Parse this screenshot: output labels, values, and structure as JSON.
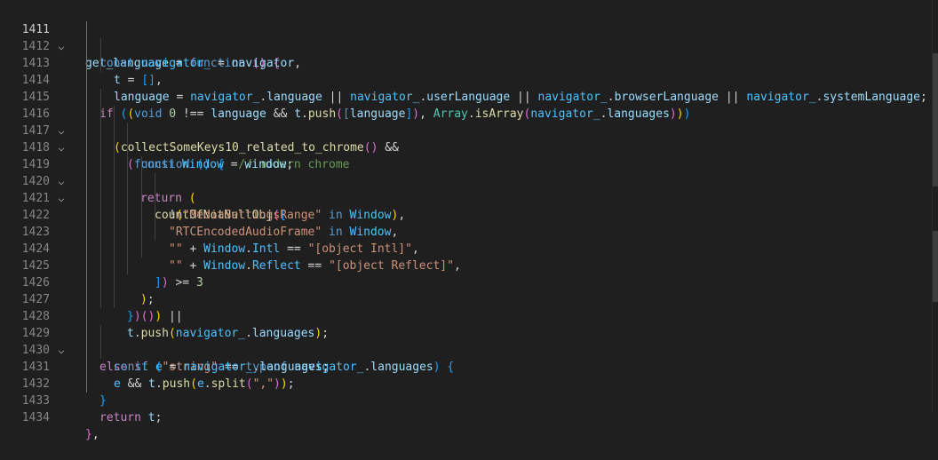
{
  "editor": {
    "line_numbers": [
      "1411",
      "1412",
      "1413",
      "1414",
      "1415",
      "1416",
      "1417",
      "1418",
      "1419",
      "1420",
      "1421",
      "1422",
      "1423",
      "1424",
      "1425",
      "1426",
      "1427",
      "1428",
      "1429",
      "1430",
      "1431",
      "1432",
      "1433",
      "1434"
    ],
    "code": {
      "l1411": [
        "get_language",
        " = ",
        "function",
        " ",
        "(",
        ")",
        " ",
        "{"
      ],
      "l1412": [
        "const",
        " ",
        "navigator_",
        " = ",
        "navigator",
        ","
      ],
      "l1413": [
        "t",
        " = ",
        "[",
        "]",
        ","
      ],
      "l1414": [
        "language",
        " = ",
        "navigator_",
        ".",
        "language",
        " || ",
        "navigator_",
        ".",
        "userLanguage",
        " || ",
        "navigator_",
        ".",
        "browserLanguage",
        " || ",
        "navigator_",
        ".",
        "systemLanguage",
        ";"
      ],
      "l1415": [
        "if",
        " ",
        "(",
        "(",
        "void",
        " ",
        "0",
        " !== ",
        "language",
        " && ",
        "t",
        ".",
        "push",
        "(",
        "[",
        "language",
        "]",
        ")",
        ", ",
        "Array",
        ".",
        "isArray",
        "(",
        "navigator_",
        ".",
        "languages",
        ")",
        ")",
        ")"
      ],
      "l1416": [
        "(",
        "collectSomeKeys10_related_to_chrome",
        "(",
        ")",
        " &&"
      ],
      "l1417": [
        "(",
        "function",
        " ",
        "(",
        ")",
        " ",
        "{",
        "  ",
        "// modern chrome"
      ],
      "l1418": [
        "const",
        " ",
        "Window",
        " = ",
        "window",
        ";"
      ],
      "l1419": [
        "return",
        " ",
        "("
      ],
      "l1420": [
        "countOfNotNullObj",
        "(",
        "["
      ],
      "l1421": [
        "!",
        "(",
        "\"MediaSettingsRange\"",
        " ",
        "in",
        " ",
        "Window",
        ")",
        ","
      ],
      "l1422": [
        "\"RTCEncodedAudioFrame\"",
        " ",
        "in",
        " ",
        "Window",
        ","
      ],
      "l1423": [
        "\"\"",
        " + ",
        "Window",
        ".",
        "Intl",
        " == ",
        "\"[object Intl]\"",
        ","
      ],
      "l1424": [
        "\"\"",
        " + ",
        "Window",
        ".",
        "Reflect",
        " == ",
        "\"[object Reflect]\"",
        ","
      ],
      "l1425": [
        "]",
        ")",
        " >= ",
        "3"
      ],
      "l1426": [
        ")",
        ";"
      ],
      "l1427": [
        "}",
        ")",
        "(",
        ")",
        ")",
        " ||"
      ],
      "l1428": [
        "t",
        ".",
        "push",
        "(",
        "navigator_",
        ".",
        "languages",
        ")",
        ";"
      ],
      "l1429": [
        "else",
        " ",
        "if",
        " ",
        "(",
        "\"string\"",
        " == ",
        "typeof",
        " ",
        "navigator_",
        ".",
        "languages",
        ")",
        " ",
        "{"
      ],
      "l1430": [
        "const",
        " ",
        "e",
        " = ",
        "navigator_",
        ".",
        "languages",
        ";"
      ],
      "l1431": [
        "e",
        " && ",
        "t",
        ".",
        "push",
        "(",
        "e",
        ".",
        "split",
        "(",
        "\",\"",
        ")",
        ")",
        ";"
      ],
      "l1432": [
        "}"
      ],
      "l1433": [
        "return",
        " ",
        "t",
        ";"
      ],
      "l1434": [
        "}",
        ","
      ]
    },
    "colors": {
      "background": "#1f1f1f",
      "keyword": "#569cd6",
      "control": "#c586c0",
      "function": "#dcdcaa",
      "variable": "#9cdcfe",
      "string": "#ce9178",
      "comment": "#6a9955"
    }
  }
}
